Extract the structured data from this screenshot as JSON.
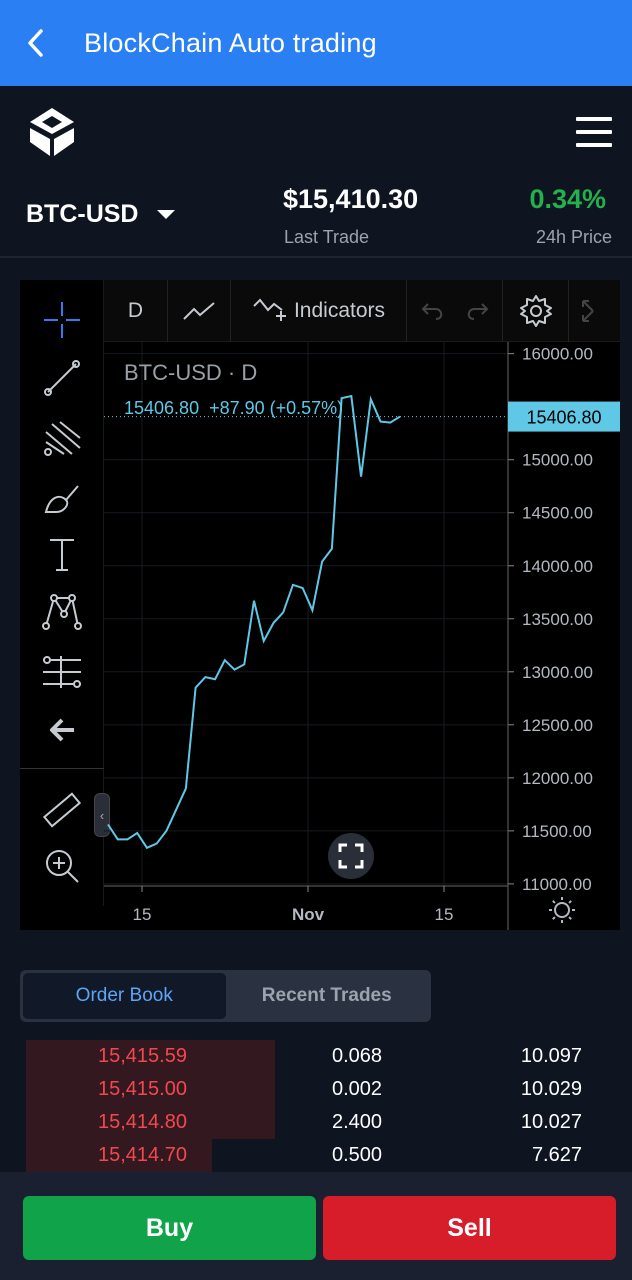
{
  "appbar": {
    "title": "BlockChain Auto trading",
    "back_icon": "chevron-left-icon"
  },
  "header": {
    "logo_icon": "blockchain-logo-icon",
    "menu_icon": "hamburger-menu-icon"
  },
  "ticker": {
    "pair": "BTC-USD",
    "price": "$15,410.30",
    "price_label": "Last Trade",
    "change": "0.34%",
    "change_label": "24h Price",
    "change_color": "#22b14c"
  },
  "chart_toolbar": {
    "interval": "D",
    "indicators": "Indicators"
  },
  "chart_data": {
    "type": "line",
    "title": "BTC-USD · D",
    "legend": "15406.80  +87.90 (+0.57%)",
    "series": [
      {
        "values": [
          11560,
          11420,
          11420,
          11480,
          11340,
          11380,
          11500,
          11700,
          11900,
          12850,
          12950,
          12930,
          13110,
          13020,
          13070,
          13670,
          13290,
          13460,
          13560,
          13820,
          13790,
          13580,
          14040,
          14160,
          15580,
          15600,
          14840,
          15570,
          15360,
          15350,
          15406.8
        ]
      }
    ],
    "x_ticks": [
      "15",
      "Nov",
      "15"
    ],
    "y_ticks": [
      "16000.00",
      "15000.00",
      "14500.00",
      "14000.00",
      "13500.00",
      "13000.00",
      "12500.00",
      "12000.00",
      "11500.00",
      "11000.00"
    ],
    "ylim": [
      10980,
      16110
    ],
    "last_value": "15406.80",
    "line_color": "#5ec8e6"
  },
  "order_tabs": {
    "order_book": "Order Book",
    "recent_trades": "Recent Trades"
  },
  "order_book": [
    {
      "price": "15,415.59",
      "amount": "0.068",
      "total": "10.097",
      "depth": 0.43
    },
    {
      "price": "15,415.00",
      "amount": "0.002",
      "total": "10.029",
      "depth": 0.43
    },
    {
      "price": "15,414.80",
      "amount": "2.400",
      "total": "10.027",
      "depth": 0.43
    },
    {
      "price": "15,414.70",
      "amount": "0.500",
      "total": "7.627",
      "depth": 0.32
    }
  ],
  "actions": {
    "buy": "Buy",
    "sell": "Sell"
  }
}
